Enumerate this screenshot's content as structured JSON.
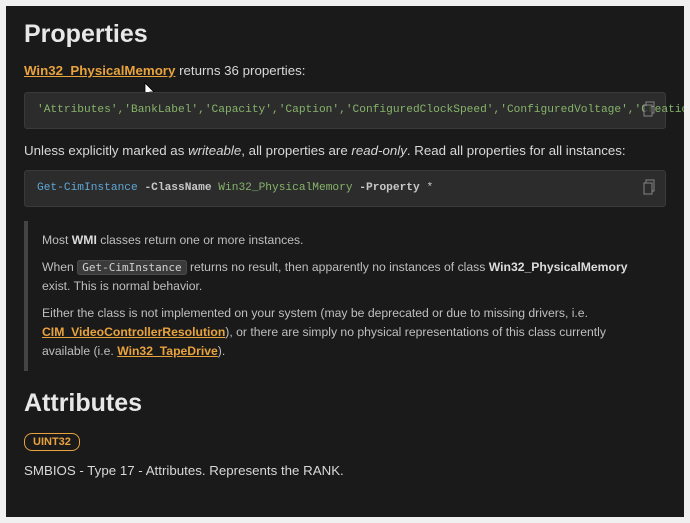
{
  "section1": {
    "title": "Properties",
    "class_link": "Win32_PhysicalMemory",
    "intro_suffix": " returns 36 properties:",
    "properties_code": "'Attributes','BankLabel','Capacity','Caption','ConfiguredClockSpeed','ConfiguredVoltage','CreationClassName','DataWidth','Description','DeviceLocator','FormFactor','HotSwappable','InstallDate','InterleaveDataDepth','InterleavePosition','Manufacturer','MaxVoltage','MemoryType','MinVoltage','Model','Name','OtherIdentifyingInfo','PartNumber','PositionInRow','PoweredOn','Removable','Replaceable','SerialNumber','SKU','SMBIOSMemoryType','Speed','Status','Tag','TotalWidth','TypeDetail','Version'",
    "mid_pre": "Unless explicitly marked as ",
    "mid_em1": "writeable",
    "mid_mid": ", all properties are ",
    "mid_em2": "read-only",
    "mid_post": ". Read all properties for all instances:",
    "ps": {
      "cmd": "Get-CimInstance",
      "p1": "-ClassName",
      "cls": "Win32_PhysicalMemory",
      "p2": "-Property",
      "star": "*"
    },
    "note": {
      "l1a": "Most ",
      "l1b": "WMI",
      "l1c": " classes return one or more instances.",
      "l2a": "When ",
      "l2code": "Get-CimInstance",
      "l2b": " returns no result, then apparently no instances of class ",
      "l2cls": "Win32_PhysicalMemory",
      "l2c": " exist. This is normal behavior.",
      "l3a": "Either the class is not implemented on your system (may be deprecated or due to missing drivers, i.e. ",
      "l3link1": "CIM_VideoControllerResolution",
      "l3b": "), or there are simply no physical representations of this class currently available (i.e. ",
      "l3link2": "Win32_TapeDrive",
      "l3c": ")."
    }
  },
  "section2": {
    "title": "Attributes",
    "type": "UINT32",
    "desc": "SMBIOS - Type 17 - Attributes. Represents the RANK."
  }
}
